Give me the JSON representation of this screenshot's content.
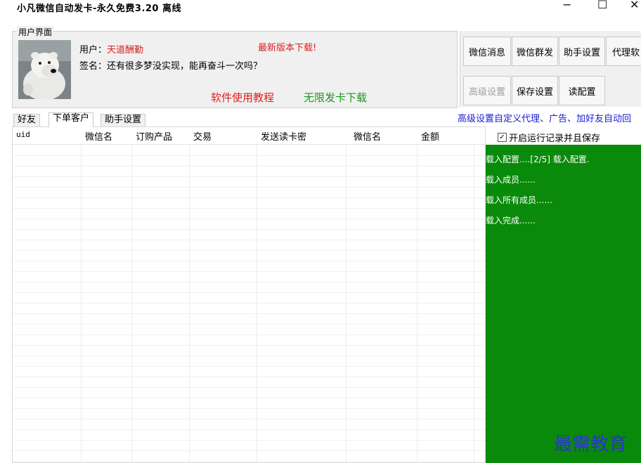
{
  "window": {
    "title": "小凡微信自动发卡-永久免费3.20  离线",
    "controls": {
      "minimize": "−",
      "maximize": "☐",
      "close": "✕"
    }
  },
  "user_panel": {
    "group_label": "用户界面",
    "user_label": "用户：",
    "user_name": "天道酬勤",
    "signature_label": "签名：",
    "signature": "还有很多梦没实现，能再奋斗一次吗？",
    "latest_download": "最新版本下载!",
    "tutorial_link": "软件使用教程",
    "unlimited_download": "无限发卡下载"
  },
  "buttons": {
    "wechat_message": "微信消息",
    "wechat_group_send": "微信群发",
    "assistant_settings": "助手设置",
    "agent_software": "代理软",
    "advanced_settings": "高级设置",
    "save_settings": "保存设置",
    "load_config": "读配置"
  },
  "tabs": [
    {
      "label": "好友",
      "active": false
    },
    {
      "label": "下单客户",
      "active": true
    },
    {
      "label": "助手设置",
      "active": false
    }
  ],
  "promo_link": "高级设置自定义代理、广告、加好友自动回",
  "table": {
    "columns": [
      "uid",
      "微信名",
      "订购产品",
      "交易",
      "发送读卡密",
      "微信名",
      "金额"
    ],
    "rows": []
  },
  "log": {
    "checkbox_label": "开启运行记录并且保存",
    "checkbox_checked": true,
    "lines": [
      "载入配置....[2/5] 载入配置.",
      "载入成员......",
      "载入所有成员......",
      "载入完成......"
    ]
  },
  "watermark": "最需教育",
  "colors": {
    "log_bg": "#0a8a0a",
    "accent_red": "#e01e1e",
    "accent_green": "#1a9a1a",
    "link_blue": "#1a1ad6"
  }
}
